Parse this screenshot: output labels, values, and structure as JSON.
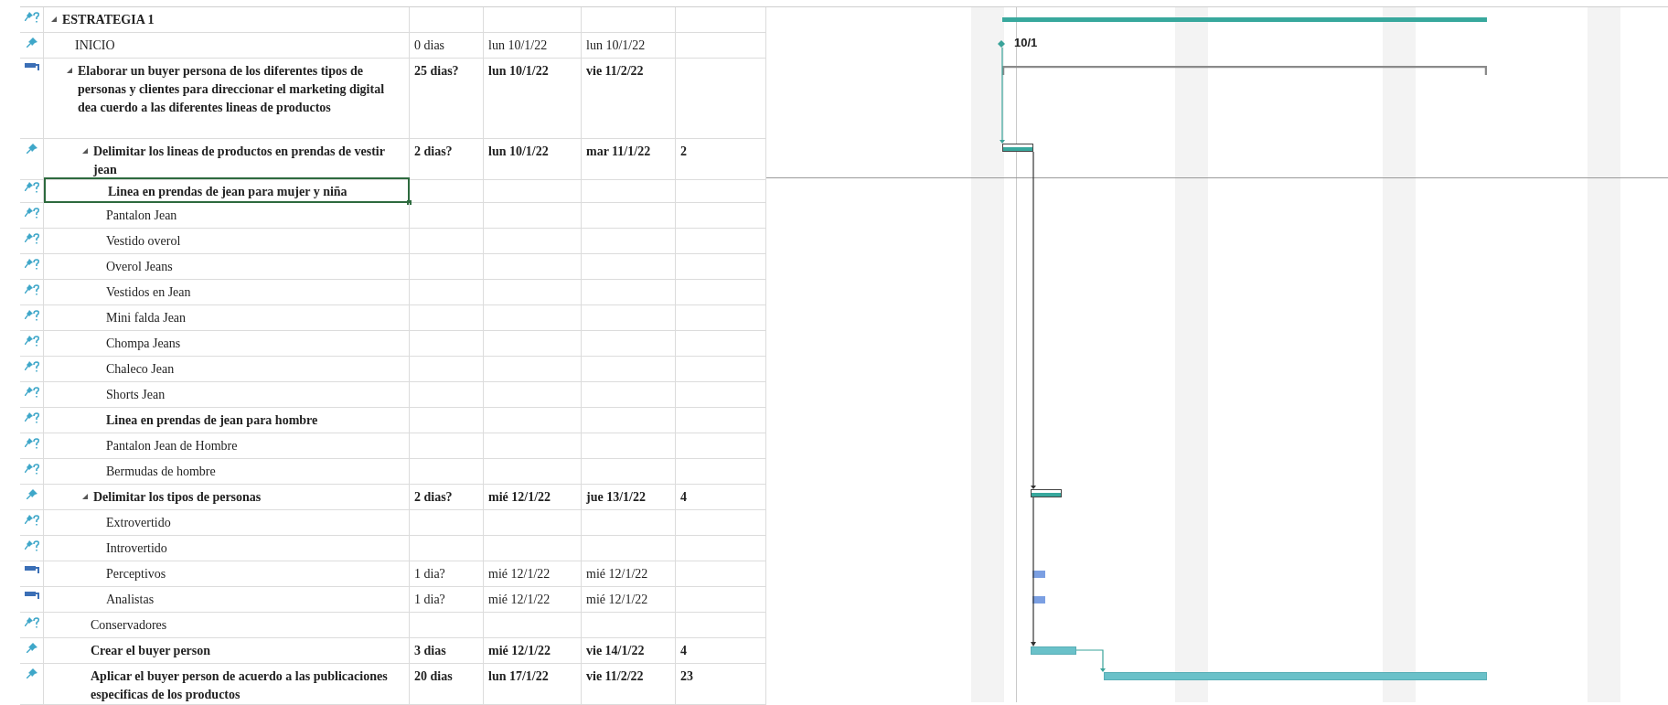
{
  "rows": [
    {
      "kind": "manual",
      "name": "ESTRATEGIA 1",
      "bold": true,
      "expanded": true,
      "selected": false,
      "bar": {
        "kind": "project-summary"
      },
      "children": [
        {
          "kind": "auto",
          "name": "INICIO",
          "bold": false,
          "selected": false,
          "duration": "0 dias",
          "start": "lun 10/1/22",
          "finish": "lun 10/1/22",
          "bar": {
            "kind": "milestone",
            "label": "10/1"
          }
        },
        {
          "kind": "bar",
          "name": "Elaborar un buyer persona de los diferentes tipos de personas y clientes para direccionar el marketing digital dea cuerdo a las diferentes lineas de productos",
          "bold": true,
          "expanded": true,
          "selected": false,
          "duration": "25 dias?",
          "start": "lun 10/1/22",
          "finish": "vie 11/2/22",
          "bar": {
            "kind": "manual-summary"
          },
          "children": [
            {
              "kind": "auto",
              "name": "Delimitar los lineas de productos en prendas de vestir jean",
              "bold": true,
              "expanded": true,
              "selected": false,
              "duration": "2 dias?",
              "start": "lun 10/1/22",
              "finish": "mar 11/1/22",
              "column_6": "2",
              "bar": {
                "kind": "summary"
              },
              "children": [
                {
                  "kind": "manual",
                  "name": "Linea en prendas de jean para mujer y niña",
                  "bold": true,
                  "selected": true
                },
                {
                  "kind": "manual",
                  "name": "Pantalon Jean",
                  "bold": false,
                  "selected": false
                },
                {
                  "kind": "manual",
                  "name": "Vestido overol",
                  "bold": false,
                  "selected": false
                },
                {
                  "kind": "manual",
                  "name": "Overol Jeans",
                  "bold": false,
                  "selected": false
                },
                {
                  "kind": "manual",
                  "name": "Vestidos en Jean",
                  "bold": false,
                  "selected": false
                },
                {
                  "kind": "manual",
                  "name": "Mini falda Jean",
                  "bold": false,
                  "selected": false
                },
                {
                  "kind": "manual",
                  "name": "Chompa Jeans",
                  "bold": false,
                  "selected": false
                },
                {
                  "kind": "manual",
                  "name": "Chaleco Jean",
                  "bold": false,
                  "selected": false
                },
                {
                  "kind": "manual",
                  "name": "Shorts Jean",
                  "bold": false,
                  "selected": false
                },
                {
                  "kind": "manual",
                  "name": "Linea en prendas de jean para hombre",
                  "bold": true,
                  "selected": false
                },
                {
                  "kind": "manual",
                  "name": "Pantalon Jean de Hombre",
                  "bold": false,
                  "selected": false
                },
                {
                  "kind": "manual",
                  "name": "Bermudas de hombre",
                  "bold": false,
                  "selected": false
                }
              ]
            },
            {
              "kind": "auto",
              "name": "Delimitar los tipos de personas",
              "bold": true,
              "expanded": true,
              "selected": false,
              "duration": "2 dias?",
              "start": "mié 12/1/22",
              "finish": "jue 13/1/22",
              "column_6": "4",
              "bar": {
                "kind": "summary"
              },
              "children": [
                {
                  "kind": "manual",
                  "name": "Extrovertido",
                  "bold": false,
                  "selected": false
                },
                {
                  "kind": "manual",
                  "name": "Introvertido",
                  "bold": false,
                  "selected": false
                },
                {
                  "kind": "bar",
                  "name": "Perceptivos",
                  "bold": false,
                  "selected": false,
                  "duration": "1 dia?",
                  "start": "mié 12/1/22",
                  "finish": "mié 12/1/22",
                  "bar": {
                    "kind": "manual-task"
                  }
                },
                {
                  "kind": "bar",
                  "name": "Analistas",
                  "bold": false,
                  "selected": false,
                  "duration": "1 dia?",
                  "start": "mié 12/1/22",
                  "finish": "mié 12/1/22",
                  "bar": {
                    "kind": "manual-task"
                  }
                }
              ]
            },
            {
              "kind": "manual",
              "name": "Conservadores",
              "bold": false,
              "selected": false
            },
            {
              "kind": "auto",
              "name": "Crear el buyer person",
              "bold": true,
              "selected": false,
              "duration": "3 dias",
              "start": "mié 12/1/22",
              "finish": "vie 14/1/22",
              "column_6": "4",
              "bar": {
                "kind": "task"
              }
            },
            {
              "kind": "auto",
              "name": "Aplicar el buyer person de acuerdo a las publicaciones especificas de los productos",
              "bold": true,
              "selected": false,
              "duration": "20 dias",
              "start": "lun 17/1/22",
              "finish": "vie 11/2/22",
              "column_6": "23",
              "bar": {
                "kind": "task"
              }
            }
          ]
        }
      ]
    }
  ]
}
